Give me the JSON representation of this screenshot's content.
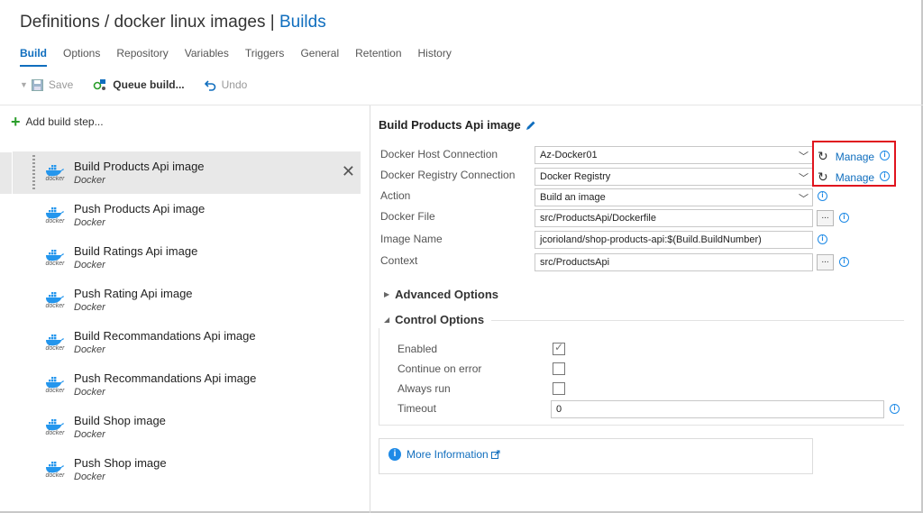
{
  "header": {
    "breadcrumb_prefix": "Definitions / docker linux images | ",
    "breadcrumb_link": "Builds"
  },
  "tabs": [
    {
      "label": "Build",
      "active": true
    },
    {
      "label": "Options",
      "active": false
    },
    {
      "label": "Repository",
      "active": false
    },
    {
      "label": "Variables",
      "active": false
    },
    {
      "label": "Triggers",
      "active": false
    },
    {
      "label": "General",
      "active": false
    },
    {
      "label": "Retention",
      "active": false
    },
    {
      "label": "History",
      "active": false
    }
  ],
  "toolbar": {
    "save_label": "Save",
    "queue_label": "Queue build...",
    "undo_label": "Undo"
  },
  "left": {
    "add_step_label": "Add build step...",
    "steps": [
      {
        "name": "Build Products Api image",
        "type": "Docker",
        "selected": true
      },
      {
        "name": "Push Products Api image",
        "type": "Docker",
        "selected": false
      },
      {
        "name": "Build Ratings Api image",
        "type": "Docker",
        "selected": false
      },
      {
        "name": "Push Rating Api image",
        "type": "Docker",
        "selected": false
      },
      {
        "name": "Build Recommandations Api image",
        "type": "Docker",
        "selected": false
      },
      {
        "name": "Push Recommandations Api image",
        "type": "Docker",
        "selected": false
      },
      {
        "name": "Build Shop image",
        "type": "Docker",
        "selected": false
      },
      {
        "name": "Push Shop image",
        "type": "Docker",
        "selected": false
      }
    ],
    "icon_caption": "docker"
  },
  "task": {
    "title": "Build Products Api image",
    "fields": {
      "host_label": "Docker Host Connection",
      "host_value": "Az-Docker01",
      "registry_label": "Docker Registry Connection",
      "registry_value": "Docker Registry",
      "action_label": "Action",
      "action_value": "Build an image",
      "file_label": "Docker File",
      "file_value": "src/ProductsApi/Dockerfile",
      "image_label": "Image Name",
      "image_value": "jcorioland/shop-products-api:$(Build.BuildNumber)",
      "context_label": "Context",
      "context_value": "src/ProductsApi"
    },
    "manage_label": "Manage",
    "ellipsis": "...",
    "advanced_label": "Advanced Options",
    "control_label": "Control Options",
    "control": {
      "enabled_label": "Enabled",
      "enabled": true,
      "continue_label": "Continue on error",
      "continue": false,
      "always_label": "Always run",
      "always": false,
      "timeout_label": "Timeout",
      "timeout_value": "0"
    },
    "more_info_label": "More Information"
  },
  "colors": {
    "accent": "#106ebe",
    "highlight_box": "#e0141e",
    "info": "#1e8ae6",
    "add_green": "#2a9d2a"
  }
}
